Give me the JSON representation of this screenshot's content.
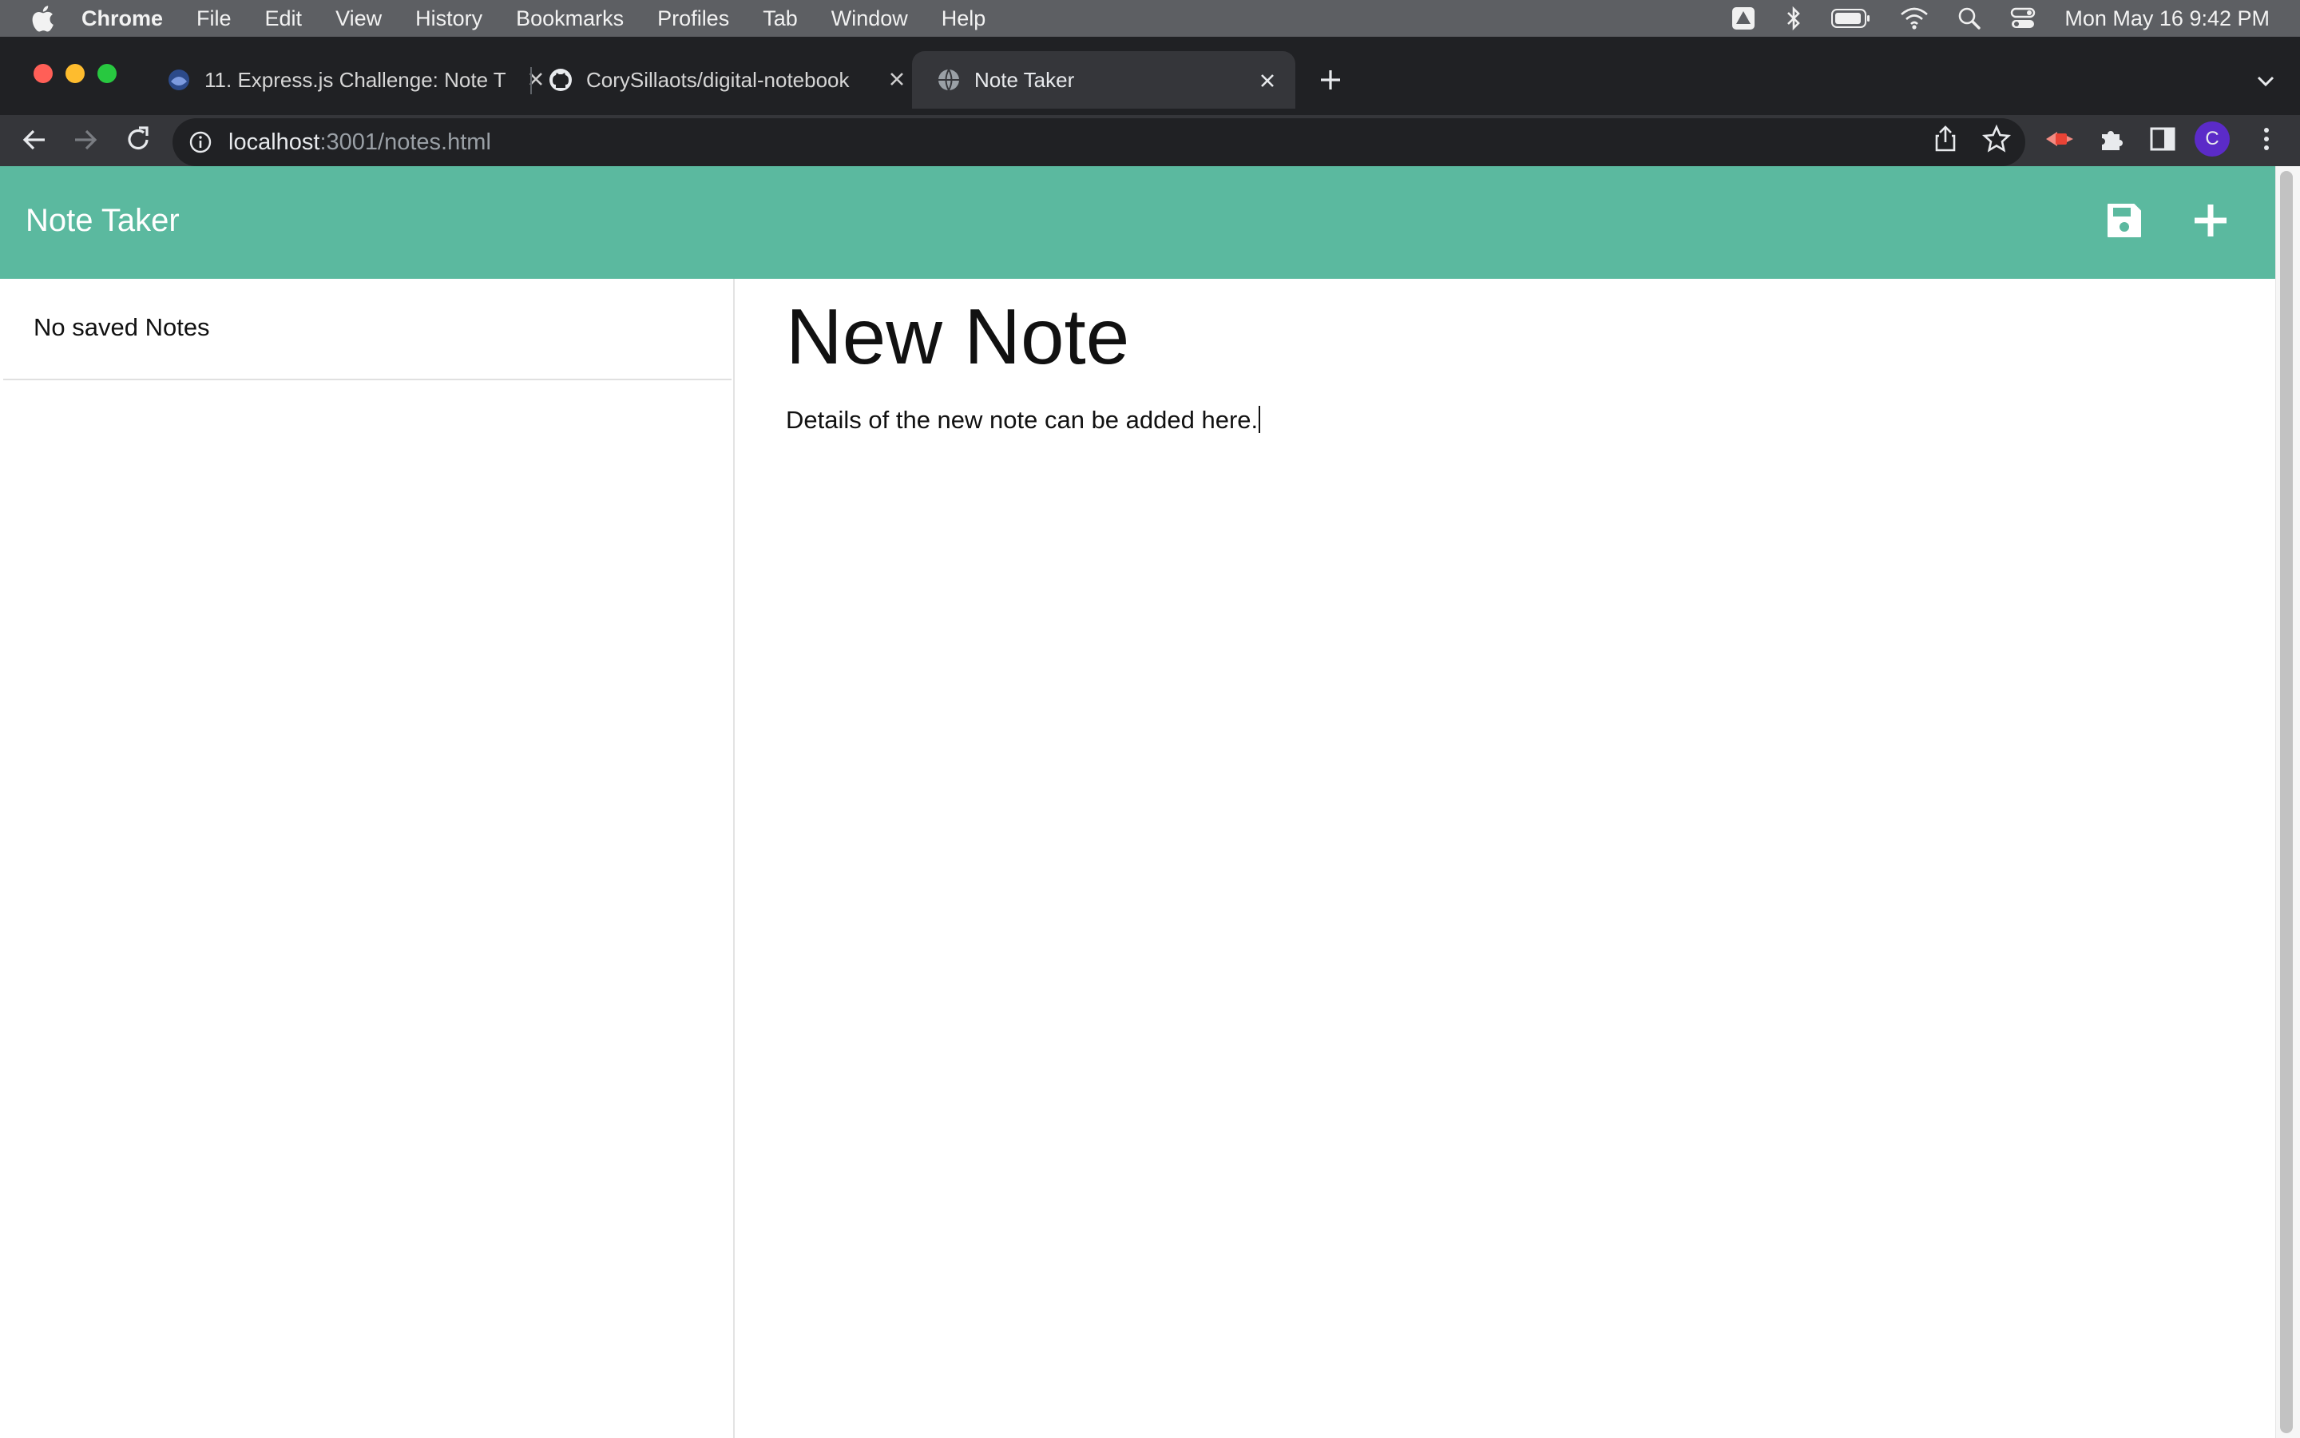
{
  "menubar": {
    "app_name": "Chrome",
    "items": [
      "File",
      "Edit",
      "View",
      "History",
      "Bookmarks",
      "Profiles",
      "Tab",
      "Window",
      "Help"
    ],
    "clock": "Mon May 16  9:42 PM"
  },
  "tabs": [
    {
      "title": "11. Express.js Challenge: Note T",
      "icon": "course-icon"
    },
    {
      "title": "CorySillaots/digital-notebook",
      "icon": "github-icon"
    },
    {
      "title": "Note Taker",
      "icon": "globe-icon",
      "active": true
    }
  ],
  "address_bar": {
    "host": "localhost",
    "path": ":3001/notes.html"
  },
  "profile": {
    "initial": "C",
    "color": "#5b2bc8"
  },
  "app": {
    "brand": "Note Taker",
    "accent_color": "#5bb99f",
    "save_icon": "save-icon",
    "new_icon": "plus-icon"
  },
  "sidebar": {
    "empty_label": "No saved Notes"
  },
  "note": {
    "title": "New Note",
    "text": "Details of the new note can be added here."
  }
}
